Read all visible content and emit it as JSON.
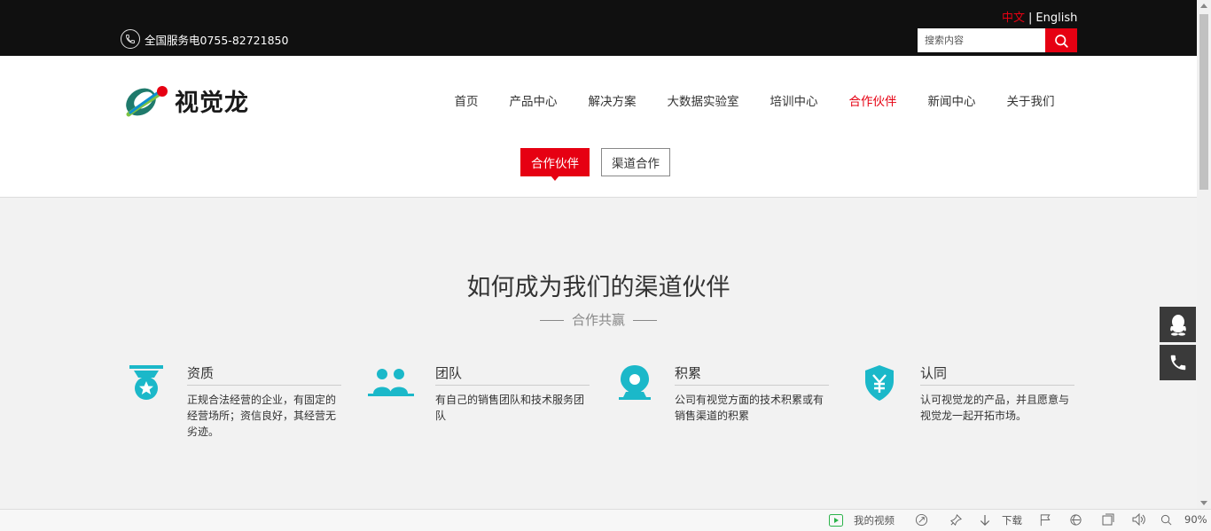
{
  "topbar": {
    "lang_zh": "中文",
    "lang_sep": "|",
    "lang_en": "English",
    "phone_text": "全国服务电0755-82721850",
    "search_placeholder": "搜索内容"
  },
  "header": {
    "logo_text": "视觉龙",
    "nav": [
      "首页",
      "产品中心",
      "解决方案",
      "大数据实验室",
      "培训中心",
      "合作伙伴",
      "新闻中心",
      "关于我们"
    ],
    "nav_active_index": 5,
    "subtabs": [
      "合作伙伴",
      "渠道合作"
    ]
  },
  "main": {
    "title": "如何成为我们的渠道伙伴",
    "subtitle": "合作共赢",
    "features": [
      {
        "icon": "medal-icon",
        "title": "资质",
        "desc": "正规合法经营的企业，有固定的经营场所；资信良好，其经营无劣迹。"
      },
      {
        "icon": "team-icon",
        "title": "团队",
        "desc": "有自己的销售团队和技术服务团队"
      },
      {
        "icon": "location-pin-icon",
        "title": "积累",
        "desc": "公司有视觉方面的技术积累或有销售渠道的积累"
      },
      {
        "icon": "yuan-shield-icon",
        "title": "认同",
        "desc": "认可视觉龙的产品，并且愿意与视觉龙一起开拓市场。"
      }
    ]
  },
  "statusbar": {
    "my_video": "我的视频",
    "download": "下载",
    "zoom": "90%"
  },
  "colors": {
    "accent": "#e60012",
    "icon": "#1bb8c9",
    "topbar": "#101010"
  }
}
